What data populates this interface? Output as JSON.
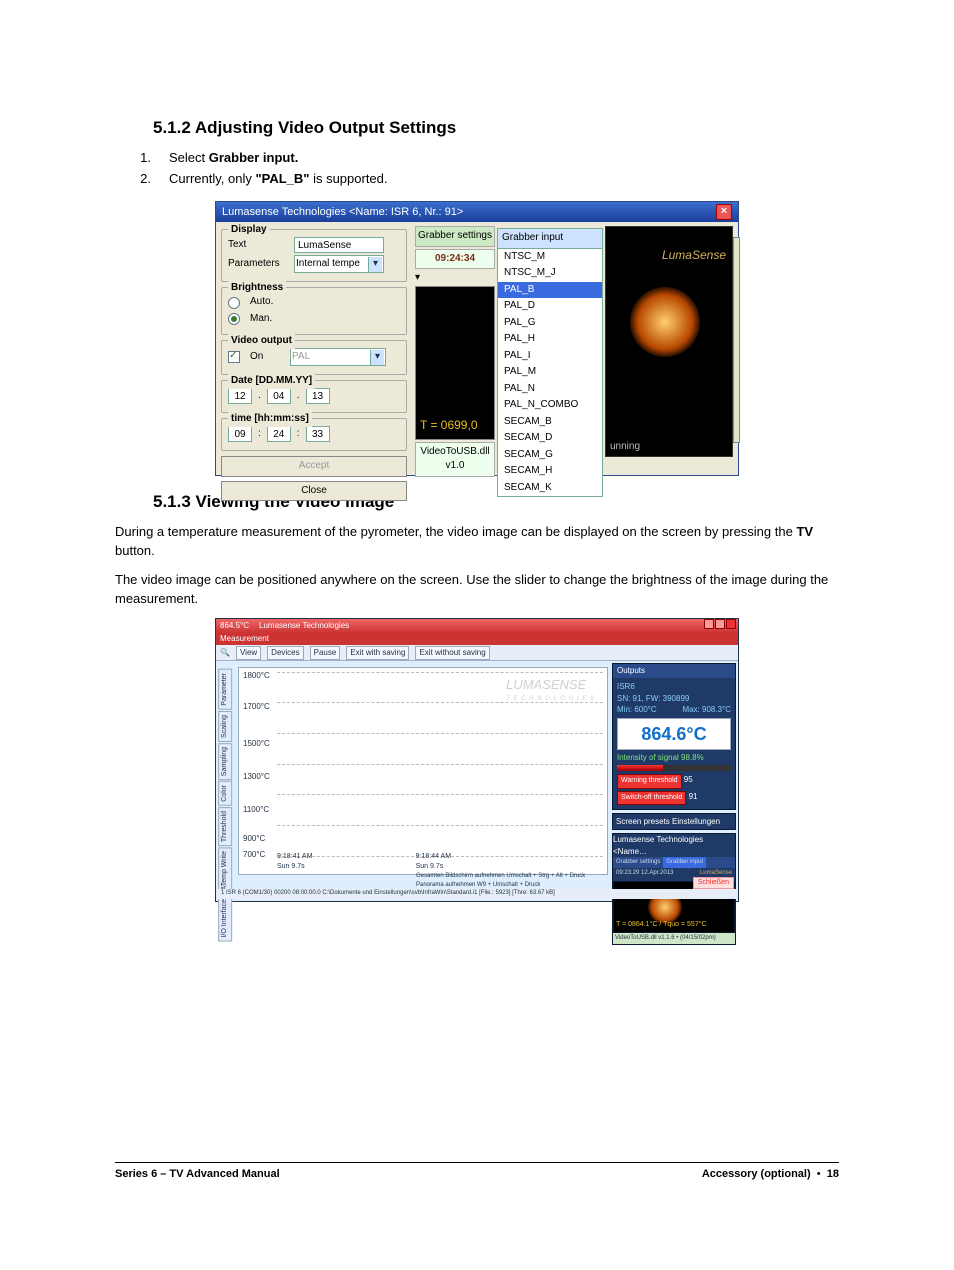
{
  "headings": {
    "h512": "5.1.2  Adjusting Video Output Settings",
    "h513": "5.1.3  Viewing the Video Image"
  },
  "list1": {
    "n1": "1.",
    "t1a": "Select ",
    "t1b": "Grabber input.",
    "n2": "2.",
    "t2a": "Currently, only ",
    "t2b": "\"PAL_B\"",
    "t2c": " is supported."
  },
  "para1a": "During a temperature measurement of the pyrometer, the video image can be displayed on the screen by pressing the ",
  "para1b": "TV",
  "para1c": " button.",
  "para2": "The video image can be positioned anywhere on the screen. Use the slider to change the brightness of the image during the measurement.",
  "fig1": {
    "title": "Lumasense Technologies   <Name: ISR 6, Nr.: 91>",
    "display": {
      "legend": "Display",
      "text_lbl": "Text",
      "text_val": "LumaSense",
      "param_lbl": "Parameters",
      "param_val": "Internal tempe"
    },
    "brightness": {
      "legend": "Brightness",
      "auto": "Auto.",
      "man": "Man."
    },
    "videoout": {
      "legend": "Video output",
      "on": "On",
      "mode": "PAL"
    },
    "date": {
      "legend": "Date [DD.MM.YY]",
      "d": "12",
      "m": "04",
      "y": "13"
    },
    "time": {
      "legend": "time [hh:mm:ss]",
      "h": "09",
      "mi": "24",
      "s": "33"
    },
    "accept": "Accept",
    "close": "Close",
    "mid": {
      "grabber_settings": "Grabber settings",
      "clock": "09:24:34",
      "tval": "T = 0699,0",
      "dll": "VideoToUSB.dll v1.0"
    },
    "menu": {
      "header": "Grabber input",
      "items": [
        "NTSC_M",
        "NTSC_M_J",
        "PAL_B",
        "PAL_D",
        "PAL_G",
        "PAL_H",
        "PAL_I",
        "PAL_M",
        "PAL_N",
        "PAL_N_COMBO",
        "SECAM_B",
        "SECAM_D",
        "SECAM_G",
        "SECAM_H",
        "SECAM_K"
      ]
    },
    "right": {
      "brand": "LumaSense",
      "status": "unning"
    }
  },
  "fig2": {
    "title_temp": "864.5°C",
    "title_app": "Lumasense Technologies",
    "menu": "Measurement",
    "toolbar": [
      "View",
      "Devices",
      "Pause",
      "Exit with saving",
      "Exit without saving"
    ],
    "vtabs": [
      "Parameter",
      "Scaling",
      "Sampling",
      "Color",
      "Threshold",
      "ATemp Write",
      "I/O Interface"
    ],
    "yticks": [
      "1800°C",
      "1700°C",
      "1500°C",
      "1300°C",
      "1100°C",
      "900°C",
      "700°C"
    ],
    "watermark": "LUMASENSE",
    "watermark2": "T E C H N O L O G I E S",
    "xtick1": "9:18:41 AM",
    "xtick1b": "Sun 9.7s",
    "xtick2": "9:18:44 AM",
    "xtick2b": "Sun 9.7s",
    "outputs_hdr": "Outputs",
    "dev_line1": "ISR6",
    "dev_line2": "SN: 91, FW: 390899",
    "dev_min": "Min: 600°C",
    "dev_max": "Max: 908.3°C",
    "bigT": "864.6°C",
    "intensity": "Intensity of signal",
    "intensity_val": "98.8%",
    "warn_btn": "Warning threshold",
    "warn_v": "95",
    "switch_btn": "Switch-off threshold",
    "switch_v": "91",
    "shot_hdr": "Screen presets    Einstellungen",
    "mini_title": "Lumasense Technologies   <Name…",
    "mini_tabs1": "Grabber settings",
    "mini_tabs2": "Grabber input",
    "mini_clock": "09:23:29  12.Apr.2013",
    "mini_brand": "LumaSense",
    "mini_tline": "T = 0864.1°C / Tquo = 557°C",
    "mini_dll": "VideoToUSB.dll v1.1.6 • (04/15/02pm)",
    "status": "1   ISR 6 (COM1/30)   00200   08:00:00.0   C:\\Dokumente und Einstellungen\\svb\\InfraWin\\Standard.i1   [File.: 5923] [Thre: 63.67 kB]",
    "hints1": "Gesamten Bildschirm aufnehmen    Umschalt + Strg + Alt + Druck",
    "hints2": "Panorama aufnehmen               W9 + Umschalt + Druck",
    "close_btn": "Schließen"
  },
  "footer": {
    "left": "Series 6 – TV Advanced Manual",
    "right_a": "Accessory (optional)",
    "bullet": "•",
    "page": "18"
  }
}
